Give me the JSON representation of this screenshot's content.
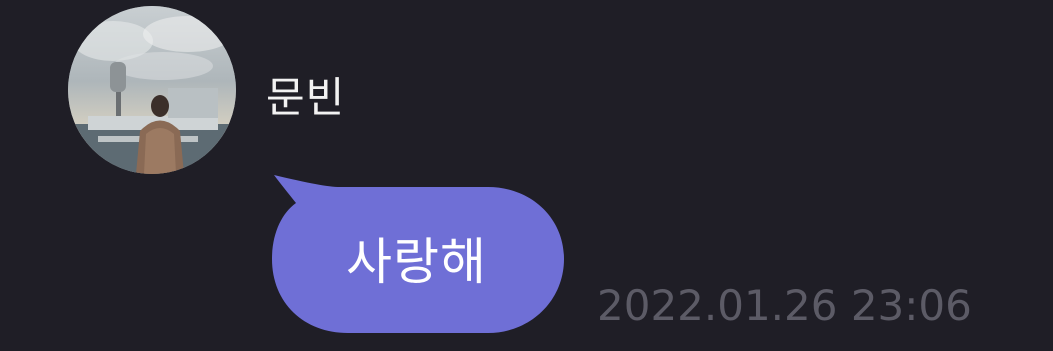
{
  "message": {
    "sender": {
      "name": "문빈",
      "avatar_icon": "profile-photo"
    },
    "text": "사랑해",
    "timestamp": "2022.01.26 23:06"
  },
  "colors": {
    "background": "#1f1e26",
    "bubble": "#6f6fd6",
    "bubble_text": "#ffffff",
    "name_text": "#f2f2f2",
    "timestamp_text": "#5c5b66"
  }
}
